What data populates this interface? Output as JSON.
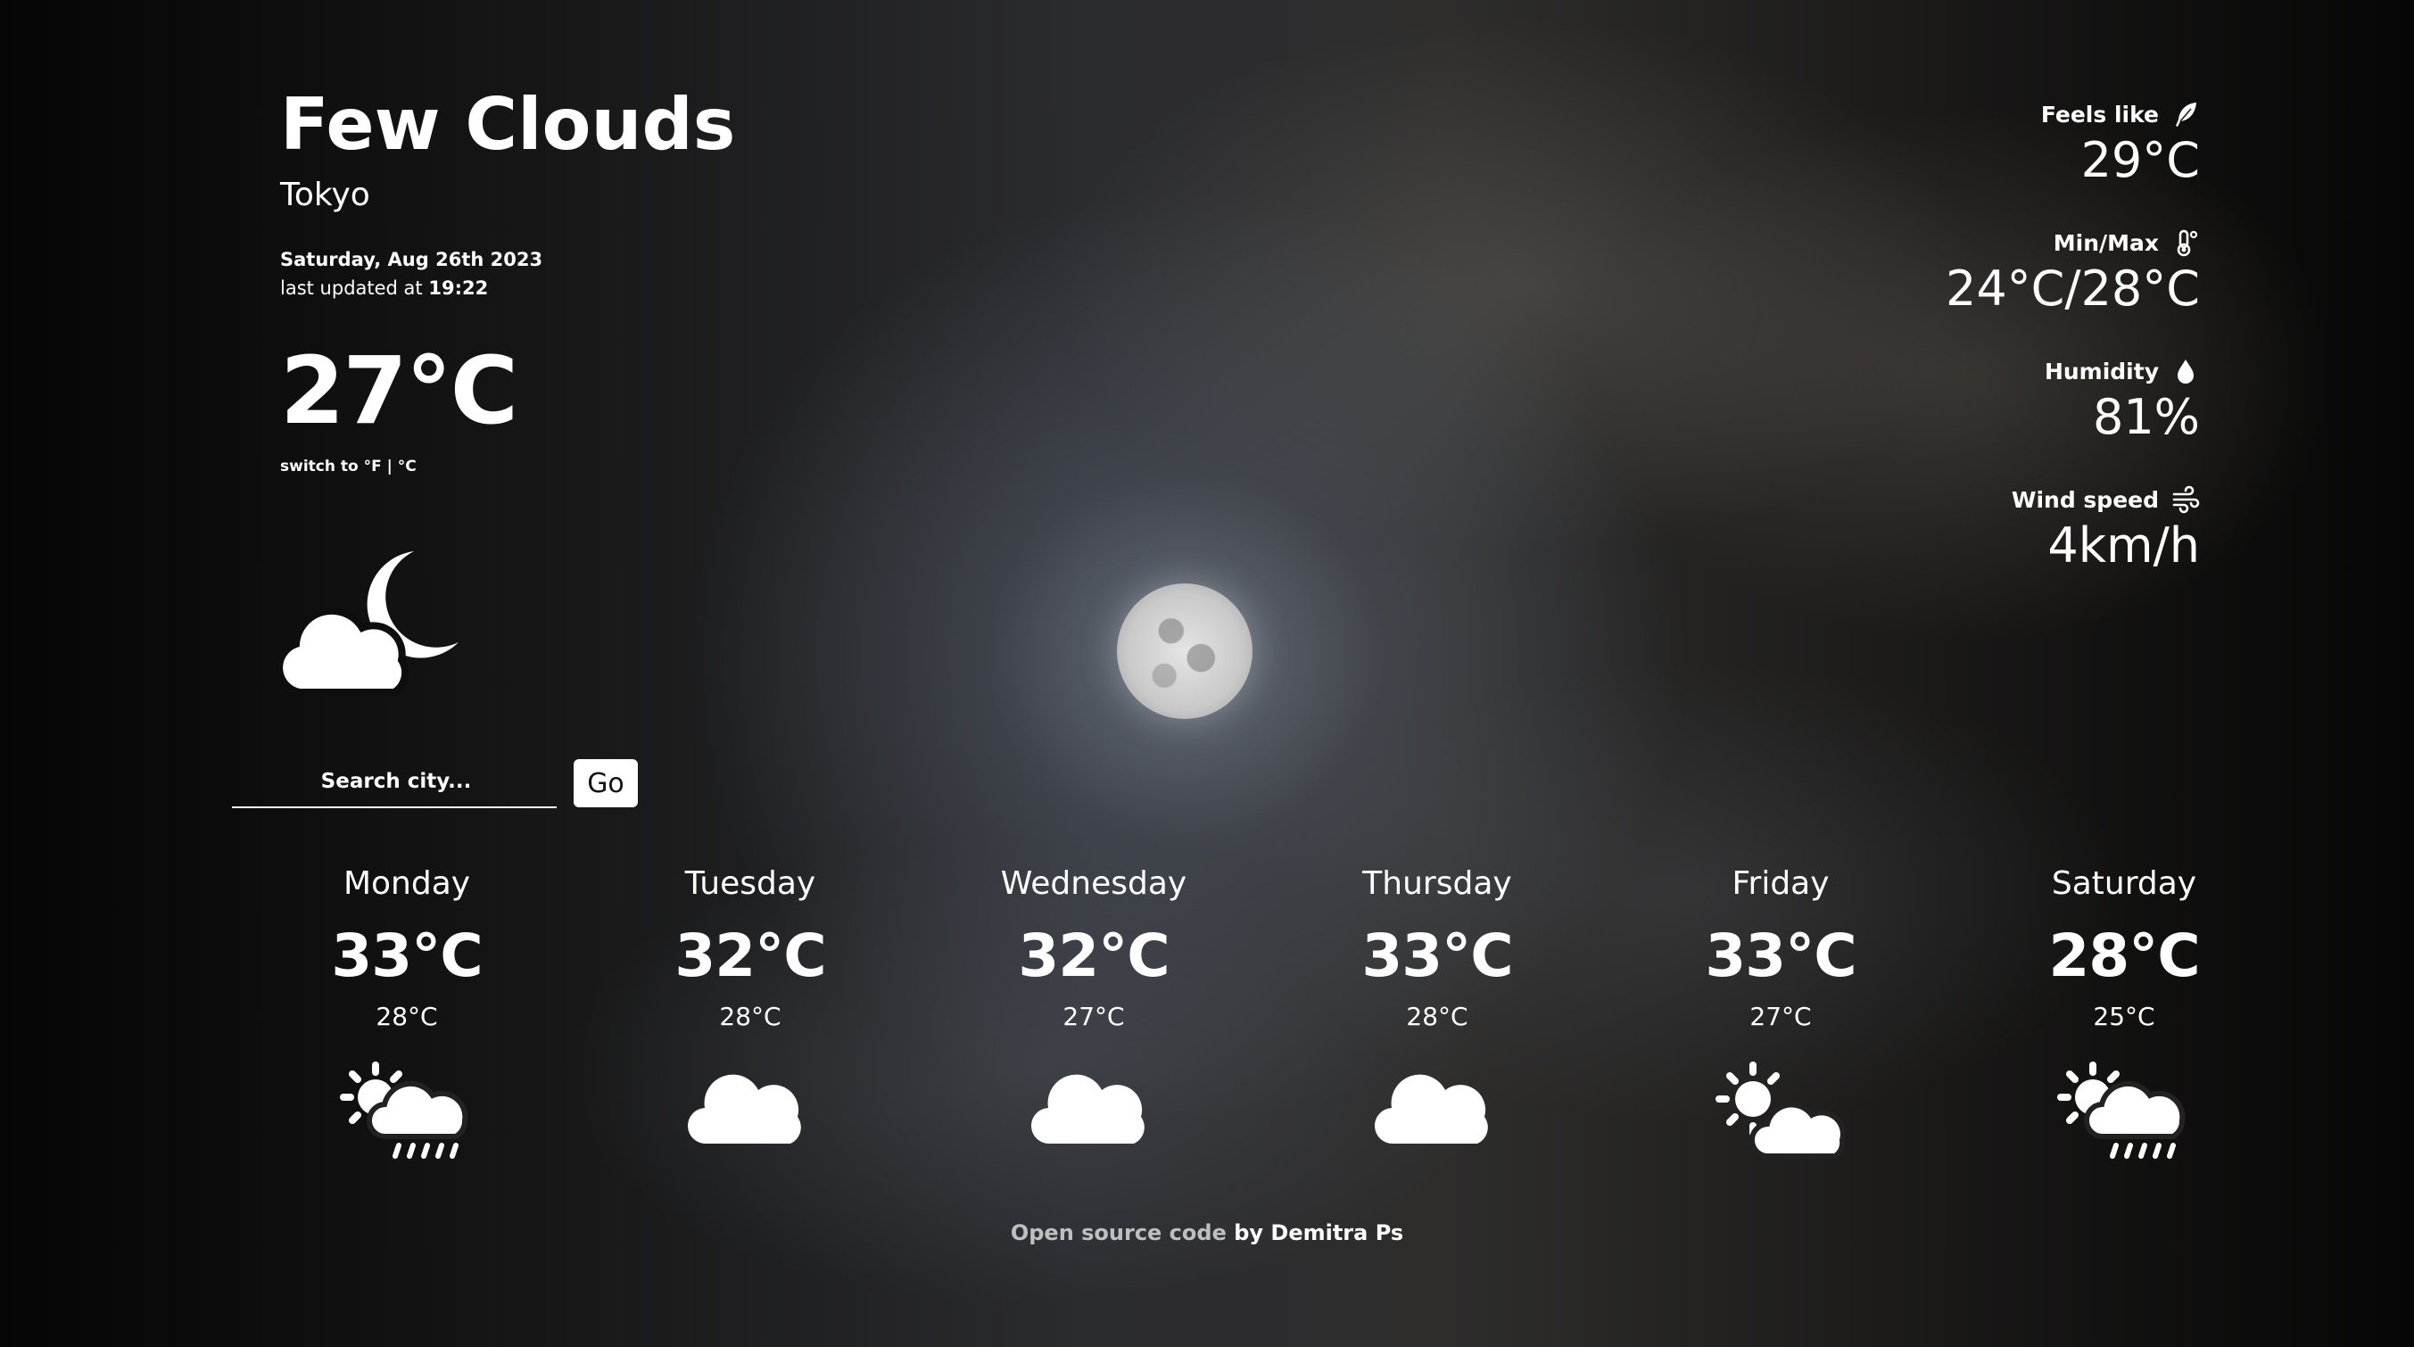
{
  "current": {
    "condition": "Few Clouds",
    "city": "Tokyo",
    "date": "Saturday, Aug 26th 2023",
    "updated_prefix": "last updated at",
    "updated_time": "19:22",
    "temperature": "27°C",
    "switch_prefix": "switch to",
    "switch_f": "°F",
    "switch_sep": "|",
    "switch_c": "°C",
    "icon": "cloud-moon-icon"
  },
  "search": {
    "placeholder": "Search city...",
    "value": "",
    "button": "Go"
  },
  "stats": {
    "feels_like": {
      "label": "Feels like",
      "value": "29°C",
      "icon": "feather-icon"
    },
    "min_max": {
      "label": "Min/Max",
      "value": "24°C/28°C",
      "icon": "thermometer-icon"
    },
    "humidity": {
      "label": "Humidity",
      "value": "81%",
      "icon": "droplet-icon"
    },
    "wind": {
      "label": "Wind speed",
      "value": "4km/h",
      "icon": "wind-icon"
    }
  },
  "forecast": [
    {
      "day": "Monday",
      "max": "33°C",
      "min": "28°C",
      "icon": "sun-cloud-rain-icon"
    },
    {
      "day": "Tuesday",
      "max": "32°C",
      "min": "28°C",
      "icon": "cloud-icon"
    },
    {
      "day": "Wednesday",
      "max": "32°C",
      "min": "27°C",
      "icon": "cloud-icon"
    },
    {
      "day": "Thursday",
      "max": "33°C",
      "min": "28°C",
      "icon": "cloud-icon"
    },
    {
      "day": "Friday",
      "max": "33°C",
      "min": "27°C",
      "icon": "sun-cloud-icon"
    },
    {
      "day": "Saturday",
      "max": "28°C",
      "min": "25°C",
      "icon": "sun-cloud-rain-icon"
    }
  ],
  "footer": {
    "source_link": "Open source code",
    "author": "by Demitra Ps"
  }
}
